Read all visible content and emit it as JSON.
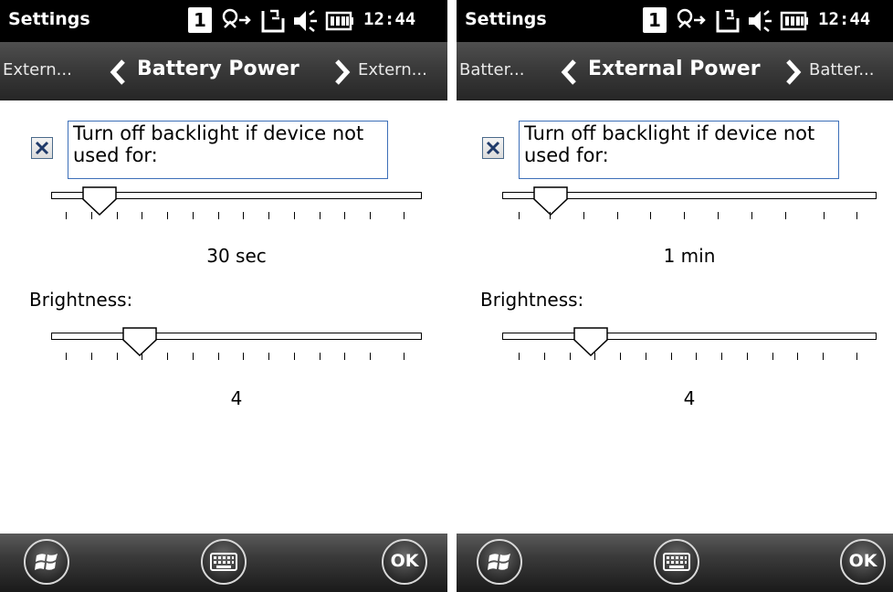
{
  "screens": [
    {
      "status": {
        "title": "Settings",
        "badge": "1",
        "time": "12:44"
      },
      "pivot": {
        "prev": "Extern...",
        "current": "Battery Power",
        "next": "Extern..."
      },
      "backlight_checkbox": {
        "checked": true,
        "label_line1": "Turn off backlight if device not",
        "label_line2": "used for:"
      },
      "backlight_slider": {
        "value_label": "30 sec",
        "position_index": 1,
        "tick_count": 14
      },
      "brightness": {
        "label": "Brightness:",
        "value_label": "4",
        "position_index": 3,
        "tick_count": 14
      },
      "bottom_bar": {
        "start_icon": "windows-start-icon",
        "keyboard_icon": "keyboard-icon",
        "ok_label": "OK"
      }
    },
    {
      "status": {
        "title": "Settings",
        "badge": "1",
        "time": "12:44"
      },
      "pivot": {
        "prev": "Batter...",
        "current": "External Power",
        "next": "Batter..."
      },
      "backlight_checkbox": {
        "checked": true,
        "label_line1": "Turn off backlight if device not",
        "label_line2": "used for:"
      },
      "backlight_slider": {
        "value_label": "1 min",
        "position_index": 1,
        "tick_count": 11
      },
      "brightness": {
        "label": "Brightness:",
        "value_label": "4",
        "position_index": 3,
        "tick_count": 14
      },
      "bottom_bar": {
        "start_icon": "windows-start-icon",
        "keyboard_icon": "keyboard-icon",
        "ok_label": "OK"
      }
    }
  ],
  "colors": {
    "status_bg": "#000000",
    "pivot_bg": "#3a3a3a",
    "focus_border": "#3d6fb8",
    "text": "#000000"
  }
}
